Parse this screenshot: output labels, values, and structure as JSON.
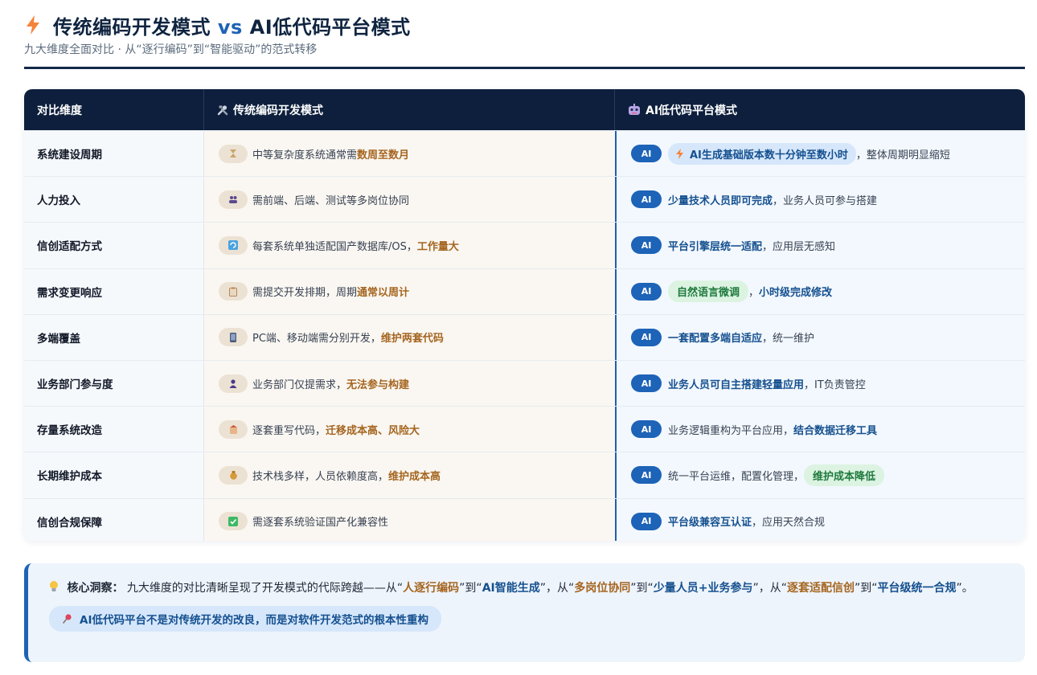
{
  "header": {
    "title_part1": "传统编码开发模式",
    "title_vs": "vs",
    "title_part2": "AI低代码平台模式",
    "subtitle": "九大维度全面对比 · 从“逐行编码”到“智能驱动”的范式转移"
  },
  "table": {
    "head": {
      "dimension": "对比维度",
      "traditional": "传统编码开发模式",
      "ai": "AI低代码平台模式"
    },
    "rows": [
      {
        "dim": "系统建设周期",
        "trad_icon": "hourglass-icon",
        "trad_a": "中等复杂度系统通常需 ",
        "trad_b": "数周至数月",
        "ai_badge": "AI",
        "ai_pill": "AI生成基础版本数十分钟至数小时",
        "ai_rest": "，整体周期明显缩短"
      },
      {
        "dim": "人力投入",
        "trad_icon": "people-icon",
        "trad_a": "需前端、后端、测试等多岗位协同",
        "ai_badge": "AI",
        "ai_hl": "少量技术人员即可完成",
        "ai_rest": "，业务人员可参与搭建"
      },
      {
        "dim": "信创适配方式",
        "trad_icon": "refresh-icon",
        "trad_a": "每套系统单独适配国产数据库/OS，",
        "trad_b": "工作量大",
        "ai_badge": "AI",
        "ai_hl": "平台引擎层统一适配",
        "ai_rest": "，应用层无感知"
      },
      {
        "dim": "需求变更响应",
        "trad_icon": "clipboard-icon",
        "trad_a": "需提交开发排期，周期 ",
        "trad_b": "通常以周计",
        "ai_badge": "AI",
        "ai_pill": "自然语言微调",
        "ai_mid": "，",
        "ai_hl": "小时级完成修改"
      },
      {
        "dim": "多端覆盖",
        "trad_icon": "phone-icon",
        "trad_a": "PC端、移动端需分别开发，",
        "trad_b": "维护两套代码",
        "ai_badge": "AI",
        "ai_hl": "一套配置多端自适应",
        "ai_rest": "，统一维护"
      },
      {
        "dim": "业务部门参与度",
        "trad_icon": "person-icon",
        "trad_a": "业务部门仅提需求，",
        "trad_b": "无法参与构建",
        "ai_badge": "AI",
        "ai_hl": "业务人员可自主搭建轻量应用",
        "ai_rest": "，IT负责管控"
      },
      {
        "dim": "存量系统改造",
        "trad_icon": "building-icon",
        "trad_a": "逐套重写代码，",
        "trad_b": "迁移成本高、风险大",
        "ai_badge": "AI",
        "ai_plain": "业务逻辑重构为平台应用，",
        "ai_hl": "结合数据迁移工具"
      },
      {
        "dim": "长期维护成本",
        "trad_icon": "money-bag-icon",
        "trad_a": "技术栈多样，人员依赖度高，",
        "trad_b": "维护成本高",
        "ai_badge": "AI",
        "ai_plain": "统一平台运维，配置化管理，",
        "ai_pill": "维护成本降低"
      },
      {
        "dim": "信创合规保障",
        "trad_icon": "check-icon",
        "trad_a": "需逐套系统验证国产化兼容性",
        "ai_badge": "AI",
        "ai_hl": "平台级兼容互认证",
        "ai_rest": "，应用天然合规"
      }
    ]
  },
  "insight": {
    "label": "核心洞察：",
    "t1": "九大维度的对比清晰呈现了开发模式的代际跨越——从“",
    "k1": "人逐行编码",
    "t2": "”到“",
    "k2": "AI智能生成",
    "t3": "”，从“",
    "k3": "多岗位协同",
    "t4": "”到“",
    "k4": "少量人员+业务参与",
    "t5": "”，从“",
    "k5": "逐套适配信创",
    "t6": "”到“",
    "k6": "平台级统一合规",
    "t7": "”。",
    "callout": "AI低代码平台不是对传统开发的改良，而是对软件开发范式的根本性重构"
  },
  "colors": {
    "navy": "#0d1f3c",
    "accent_blue": "#1e63b5",
    "brown_highlight": "#a5651f",
    "green_pill": "#1f7a3d"
  }
}
